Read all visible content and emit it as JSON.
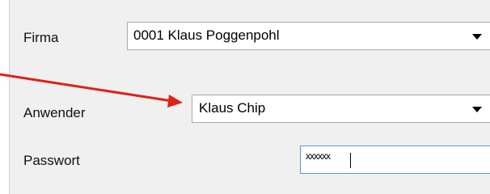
{
  "login_form": {
    "company": {
      "label": "Firma",
      "selected": "0001 Klaus Poggenpohl"
    },
    "user": {
      "label": "Anwender",
      "selected": "Klaus Chip"
    },
    "password": {
      "label": "Passwort",
      "masked_value": "xxxxxx"
    }
  },
  "annotation": {
    "arrow_color": "#e0201a"
  },
  "icons": {
    "dropdown": "chevron-down-icon"
  }
}
